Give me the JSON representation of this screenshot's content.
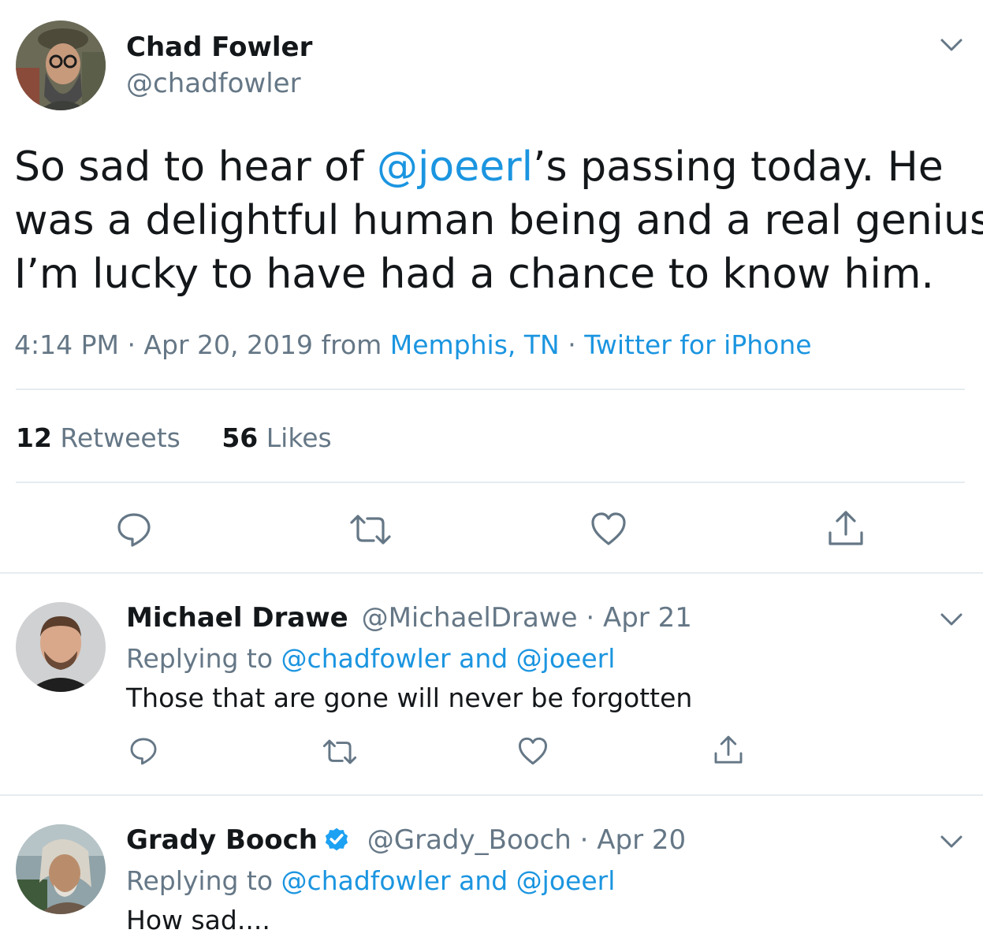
{
  "tweet": {
    "author_name": "Chad Fowler",
    "author_handle": "@chadfowler",
    "text_part1": "So sad to hear of ",
    "mention": "@joeerl",
    "text_part2": "’s passing today. He",
    "text_line2": "was a delightful human being and a real genius.",
    "text_line3": "I’m lucky to have had a chance to know him.",
    "time": "4:14 PM · Apr 20, 2019 from ",
    "location": "Memphis, TN",
    "separator": " · ",
    "source": "Twitter for iPhone",
    "retweet_count": "12",
    "retweet_label": " Retweets",
    "like_count": "56",
    "like_label": " Likes"
  },
  "replies": [
    {
      "name": "Michael Drawe",
      "handle": "@MichaelDrawe",
      "date": " · Apr 21",
      "replying_prefix": "Replying to ",
      "replying_to": "@chadfowler and @joeerl",
      "text": "Those that are gone will never be forgotten",
      "verified": false
    },
    {
      "name": "Grady Booch",
      "handle": "@Grady_Booch",
      "date": " · Apr 20",
      "replying_prefix": "Replying to ",
      "replying_to": "@chadfowler and @joeerl",
      "text": "How sad....",
      "verified": true
    }
  ],
  "icons": [
    "reply-icon",
    "retweet-icon",
    "like-icon",
    "share-icon",
    "chevron-down-icon",
    "verified-badge-icon"
  ],
  "colors": {
    "link": "#1b95e0",
    "muted": "#657786",
    "text": "#14171a",
    "divider": "#e6ecf0"
  }
}
